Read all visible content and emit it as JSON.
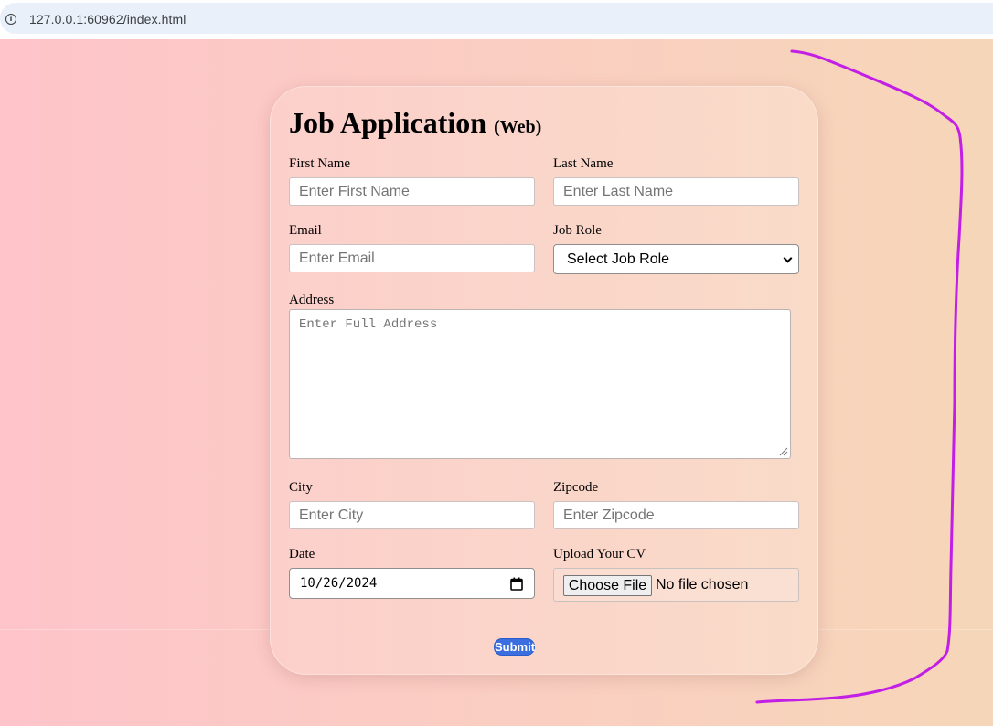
{
  "browser": {
    "url": "127.0.0.1:60962/index.html",
    "site_info_icon": "info-circle-icon"
  },
  "form": {
    "title": "Job Application",
    "title_suffix": "(Web)",
    "first_name": {
      "label": "First Name",
      "placeholder": "Enter First Name"
    },
    "last_name": {
      "label": "Last Name",
      "placeholder": "Enter Last Name"
    },
    "email": {
      "label": "Email",
      "placeholder": "Enter Email"
    },
    "job_role": {
      "label": "Job Role",
      "selected": "Select Job Role",
      "icon": "chevron-down-icon"
    },
    "address": {
      "label": "Address",
      "placeholder": "Enter Full Address"
    },
    "city": {
      "label": "City",
      "placeholder": "Enter City"
    },
    "zipcode": {
      "label": "Zipcode",
      "placeholder": "Enter Zipcode"
    },
    "date": {
      "label": "Date",
      "value": "10/26/2024",
      "icon": "calendar-icon"
    },
    "cv": {
      "label": "Upload Your CV",
      "button": "Choose File",
      "status": "No file chosen"
    },
    "submit_label": "Submit"
  },
  "colors": {
    "background_left": "#fec4ca",
    "background_right": "#f6d6b8",
    "submit_button": "#3b6fe0",
    "annotation_stroke": "#c21ee6"
  }
}
